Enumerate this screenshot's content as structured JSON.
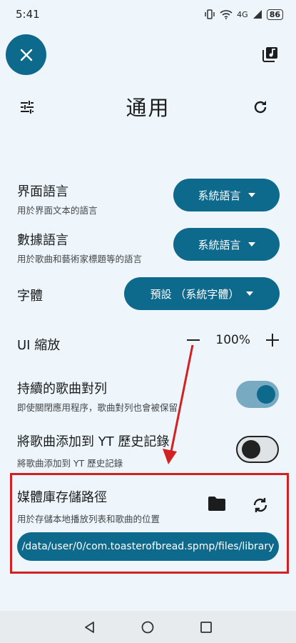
{
  "status_bar": {
    "time": "5:41",
    "network": "4G",
    "battery": "86"
  },
  "header": {
    "title": "通用"
  },
  "settings": {
    "interface_language": {
      "title": "界面語言",
      "subtitle": "用於界面文本的語言",
      "value": "系統語言"
    },
    "data_language": {
      "title": "數據語言",
      "subtitle": "用於歌曲和藝術家標題等的語言",
      "value": "系統語言"
    },
    "font": {
      "title": "字體",
      "value": "預設 （系統字體）"
    },
    "ui_scale": {
      "title": "UI 縮放",
      "value": "100%"
    },
    "persistent_queue": {
      "title": "持續的歌曲對列",
      "subtitle": "即使關閉應用程序，歌曲對列也會被保留",
      "enabled": true
    },
    "add_to_yt_history": {
      "title": "將歌曲添加到 YT 歷史記錄",
      "subtitle": "將歌曲添加到 YT 歷史記錄",
      "enabled": false
    },
    "library_path": {
      "title": "媒體庫存儲路徑",
      "subtitle": "用於存儲本地播放列表和歌曲的位置",
      "value": "/data/user/0/com.toasterofbread.spmp/files/library"
    }
  },
  "colors": {
    "accent": "#0e6a8c",
    "background": "#eef6fb",
    "annotation": "#d32020"
  }
}
